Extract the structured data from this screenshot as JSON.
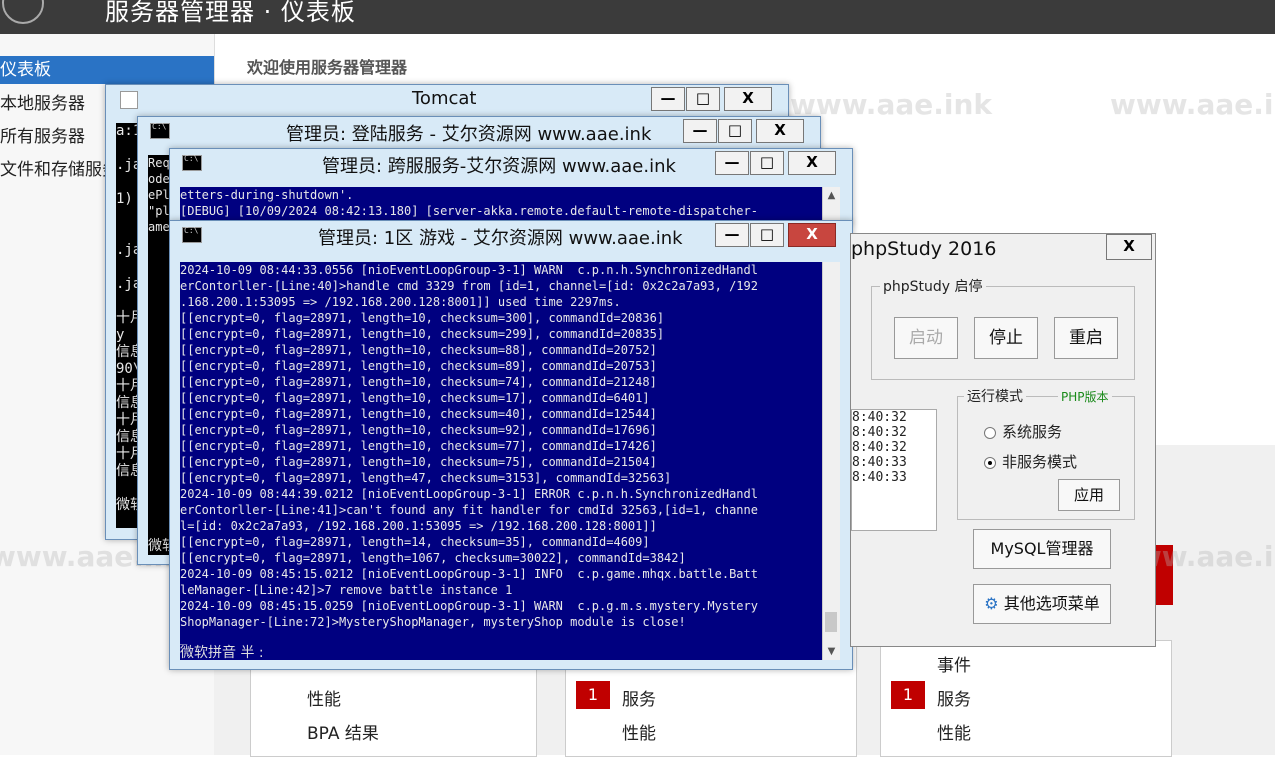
{
  "server_manager": {
    "title": "服务器管理器 · 仪表板",
    "sidebar": [
      "仪表板",
      "本地服务器",
      "所有服务器",
      "文件和存储服务"
    ],
    "welcome": "欢迎使用服务器管理器",
    "tiles": {
      "col1": [
        "性能",
        "BPA 结果"
      ],
      "col2_badge": "1",
      "col2": [
        "服务",
        "性能"
      ],
      "col3_top": "事件",
      "col3_badge": "1",
      "col3": [
        "服务",
        "性能"
      ]
    }
  },
  "watermark": "www.aae.ink",
  "tomcat": {
    "title": "Tomcat",
    "lines": [
      "a:1",
      "",
      ".ja",
      "",
      "1)",
      "",
      "",
      ".jav",
      "",
      ".ja",
      "",
      "十月",
      "y",
      "信息",
      "90\\",
      "十月",
      "信息",
      "十月",
      "信息",
      "十月",
      "信息",
      "",
      "微软"
    ]
  },
  "login_service": {
    "title": "管理员: 登陆服务 - 艾尔资源网 www.aae.ink",
    "lines": [
      "Req",
      "ode",
      "ePl",
      "\"pl",
      "ame"
    ],
    "ime": "微软"
  },
  "cross_service": {
    "title": "管理员: 跨服服务-艾尔资源网 www.aae.ink",
    "lines": [
      "etters-during-shutdown'.",
      "[DEBUG] [10/09/2024 08:42:13.180] [server-akka.remote.default-remote-dispatcher-"
    ]
  },
  "game_zone": {
    "title": "管理员: 1区 游戏 - 艾尔资源网 www.aae.ink",
    "lines": [
      "2024-10-09 08:44:33.0556 [nioEventLoopGroup-3-1] WARN  c.p.n.h.SynchronizedHandl",
      "erContorller-[Line:40]>handle cmd 3329 from [id=1, channel=[id: 0x2c2a7a93, /192",
      ".168.200.1:53095 => /192.168.200.128:8001]] used time 2297ms.",
      "[[encrypt=0, flag=28971, length=10, checksum=300], commandId=20836]",
      "[[encrypt=0, flag=28971, length=10, checksum=299], commandId=20835]",
      "[[encrypt=0, flag=28971, length=10, checksum=88], commandId=20752]",
      "[[encrypt=0, flag=28971, length=10, checksum=89], commandId=20753]",
      "[[encrypt=0, flag=28971, length=10, checksum=74], commandId=21248]",
      "[[encrypt=0, flag=28971, length=10, checksum=17], commandId=6401]",
      "[[encrypt=0, flag=28971, length=10, checksum=40], commandId=12544]",
      "[[encrypt=0, flag=28971, length=10, checksum=92], commandId=17696]",
      "[[encrypt=0, flag=28971, length=10, checksum=77], commandId=17426]",
      "[[encrypt=0, flag=28971, length=10, checksum=75], commandId=21504]",
      "[[encrypt=0, flag=28971, length=47, checksum=3153], commandId=32563]",
      "2024-10-09 08:44:39.0212 [nioEventLoopGroup-3-1] ERROR c.p.n.h.SynchronizedHandl",
      "erContorller-[Line:41]>can't found any fit handler for cmdId 32563,[id=1, channe",
      "l=[id: 0x2c2a7a93, /192.168.200.1:53095 => /192.168.200.128:8001]]",
      "[[encrypt=0, flag=28971, length=14, checksum=35], commandId=4609]",
      "[[encrypt=0, flag=28971, length=1067, checksum=30022], commandId=3842]",
      "2024-10-09 08:45:15.0212 [nioEventLoopGroup-3-1] INFO  c.p.game.mhqx.battle.Batt",
      "leManager-[Line:42]>7 remove battle instance 1",
      "2024-10-09 08:45:15.0259 [nioEventLoopGroup-3-1] WARN  c.p.g.m.s.mystery.Mystery",
      "ShopManager-[Line:72]>MysteryShopManager, mysteryShop module is close!"
    ],
    "cursor": "_",
    "ime": "微软拼音 半 :"
  },
  "phpstudy": {
    "title": "phpStudy 2016",
    "close": "X",
    "control_group": "phpStudy 启停",
    "start": "启动",
    "stop": "停止",
    "restart": "重启",
    "mode_group": "运行模式",
    "php_version": "PHP版本",
    "mode_service": "系统服务",
    "mode_nonservice": "非服务模式",
    "apply": "应用",
    "mysql": "MySQL管理器",
    "other_menu": "其他选项菜单",
    "log_times": [
      "8:40:32",
      "8:40:32",
      "8:40:32",
      "8:40:33",
      "8:40:33"
    ]
  },
  "window_buttons": {
    "min": "—",
    "max": "□",
    "close": "X"
  }
}
